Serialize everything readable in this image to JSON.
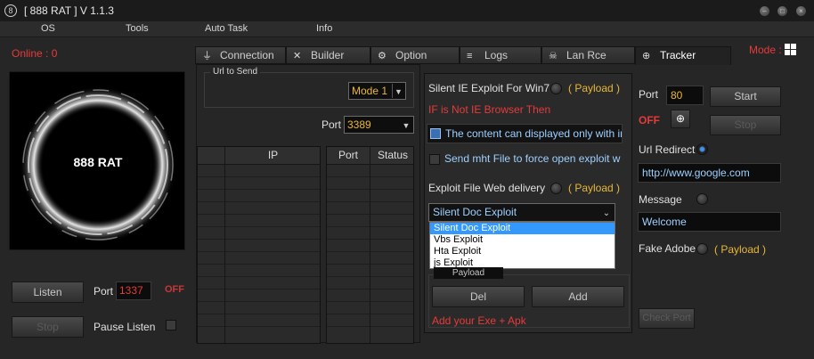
{
  "window": {
    "title": "[ 888 RAT ] V 1.1.3"
  },
  "menu": [
    "OS",
    "Tools",
    "Auto Task",
    "Info"
  ],
  "left": {
    "online": "Online : 0",
    "logo_text": "888 RAT",
    "listen_label": "Listen",
    "port_label": "Port",
    "port_value": "1337",
    "off_label": "OFF",
    "stop_label": "Stop",
    "pause_label": "Pause Listen"
  },
  "mode_label": "Mode :",
  "tabs": [
    {
      "label": "Connection",
      "icon": "plug-icon"
    },
    {
      "label": "Builder",
      "icon": "tools-icon"
    },
    {
      "label": "Option",
      "icon": "gear-icon"
    },
    {
      "label": "Logs",
      "icon": "database-icon"
    },
    {
      "label": "Lan Rce",
      "icon": "skull-icon"
    },
    {
      "label": "Tracker",
      "icon": "globe-icon"
    }
  ],
  "connection": {
    "url_legend": "Url to Send",
    "mode_value": "Mode 1",
    "port_label": "Port",
    "port_value": "3389",
    "ip_header": "IP",
    "port_header": "Port",
    "status_header": "Status"
  },
  "exploit": {
    "silent_ie_label": "Silent IE Exploit For Win7",
    "payload_label": "( Payload )",
    "not_ie_text": "IF is Not IE Browser Then",
    "content_option": "The content can displayed only with intern",
    "mht_option": "Send mht File to force open exploit with IE",
    "file_delivery_label": "Exploit File Web delivery",
    "payload_label2": "( Payload )",
    "selected_exploit": "Silent Doc Exploit",
    "options": [
      "Silent Doc Exploit",
      "Vbs Exploit",
      "Hta Exploit",
      "js Exploit"
    ],
    "payload_legend": "Payload",
    "del_label": "Del",
    "add_label": "Add",
    "add_hint": "Add your Exe  +  Apk"
  },
  "tracker": {
    "port_label": "Port",
    "port_value": "80",
    "start_label": "Start",
    "off_label": "OFF",
    "stop_label": "Stop",
    "url_redirect_label": "Url Redirect",
    "url_value": "http://www.google.com",
    "message_label": "Message",
    "message_value": "Welcome",
    "fake_adobe_label": "Fake Adobe",
    "payload_label": "( Payload )",
    "check_port_label": "Check Port"
  },
  "colors": {
    "accent_red": "#e53b3b",
    "accent_yellow": "#e8b838",
    "accent_blue": "#3399ff"
  }
}
